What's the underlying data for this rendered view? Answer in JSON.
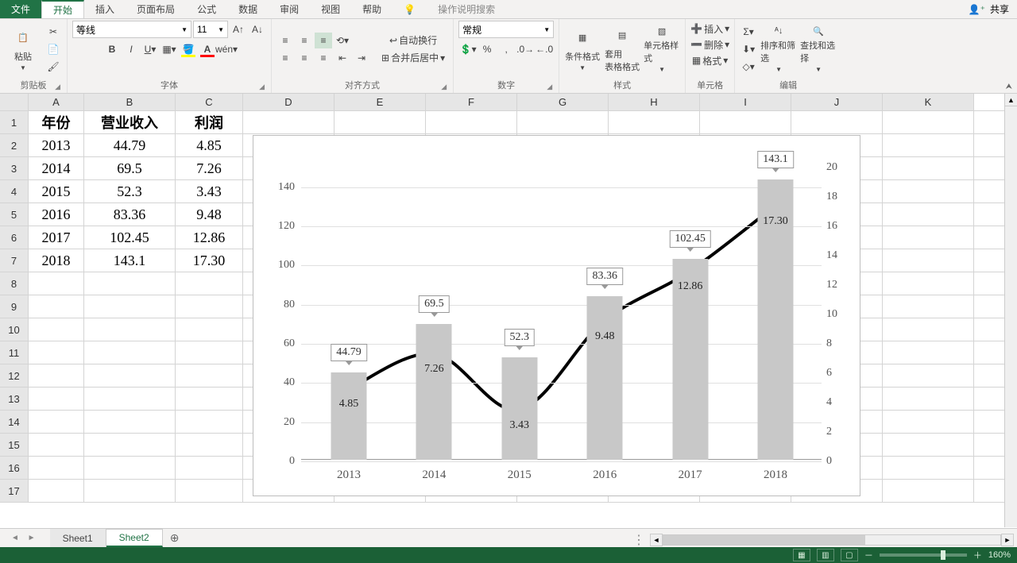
{
  "menu": {
    "file": "文件",
    "home": "开始",
    "insert": "插入",
    "pagelayout": "页面布局",
    "formulas": "公式",
    "data": "数据",
    "review": "审阅",
    "view": "视图",
    "help": "帮助",
    "tellme": "操作说明搜索",
    "share": "共享"
  },
  "ribbon": {
    "clipboard": {
      "label": "剪贴板",
      "paste": "粘贴"
    },
    "font": {
      "label": "字体",
      "name": "等线",
      "size": "11"
    },
    "align": {
      "label": "对齐方式",
      "wrap": "自动换行",
      "merge": "合并后居中"
    },
    "number": {
      "label": "数字",
      "format": "常规"
    },
    "styles": {
      "label": "样式",
      "cond": "条件格式",
      "table": "套用\n表格格式",
      "cell": "单元格样式"
    },
    "cells": {
      "label": "单元格",
      "insert": "插入",
      "delete": "删除",
      "format": "格式"
    },
    "editing": {
      "label": "编辑",
      "sort": "排序和筛选",
      "find": "查找和选择"
    }
  },
  "columns": [
    "A",
    "B",
    "C",
    "D",
    "E",
    "F",
    "G",
    "H",
    "I",
    "J",
    "K"
  ],
  "table": {
    "headers": [
      "年份",
      "营业收入",
      "利润"
    ],
    "rows": [
      [
        "2013",
        "44.79",
        "4.85"
      ],
      [
        "2014",
        "69.5",
        "7.26"
      ],
      [
        "2015",
        "52.3",
        "3.43"
      ],
      [
        "2016",
        "83.36",
        "9.48"
      ],
      [
        "2017",
        "102.45",
        "12.86"
      ],
      [
        "2018",
        "143.1",
        "17.30"
      ]
    ],
    "rownums": [
      "1",
      "2",
      "3",
      "4",
      "5",
      "6",
      "7",
      "8",
      "9",
      "10",
      "11",
      "12",
      "13",
      "14",
      "15",
      "16",
      "17"
    ]
  },
  "chart_data": {
    "type": "bar+line",
    "categories": [
      "2013",
      "2014",
      "2015",
      "2016",
      "2017",
      "2018"
    ],
    "series": [
      {
        "name": "营业收入",
        "axis": "left",
        "values": [
          44.79,
          69.5,
          52.3,
          83.36,
          102.45,
          143.1
        ]
      },
      {
        "name": "利润",
        "axis": "right",
        "values": [
          4.85,
          7.26,
          3.43,
          9.48,
          12.86,
          17.3
        ]
      }
    ],
    "left_ticks": [
      0,
      20,
      40,
      60,
      80,
      100,
      120,
      140
    ],
    "right_ticks": [
      0,
      2,
      4,
      6,
      8,
      10,
      12,
      14,
      16,
      18,
      20
    ],
    "ylim_left": [
      0,
      150
    ],
    "ylim_right": [
      0,
      20
    ]
  },
  "sheets": {
    "s1": "Sheet1",
    "s2": "Sheet2"
  },
  "status": {
    "zoom": "160%"
  }
}
